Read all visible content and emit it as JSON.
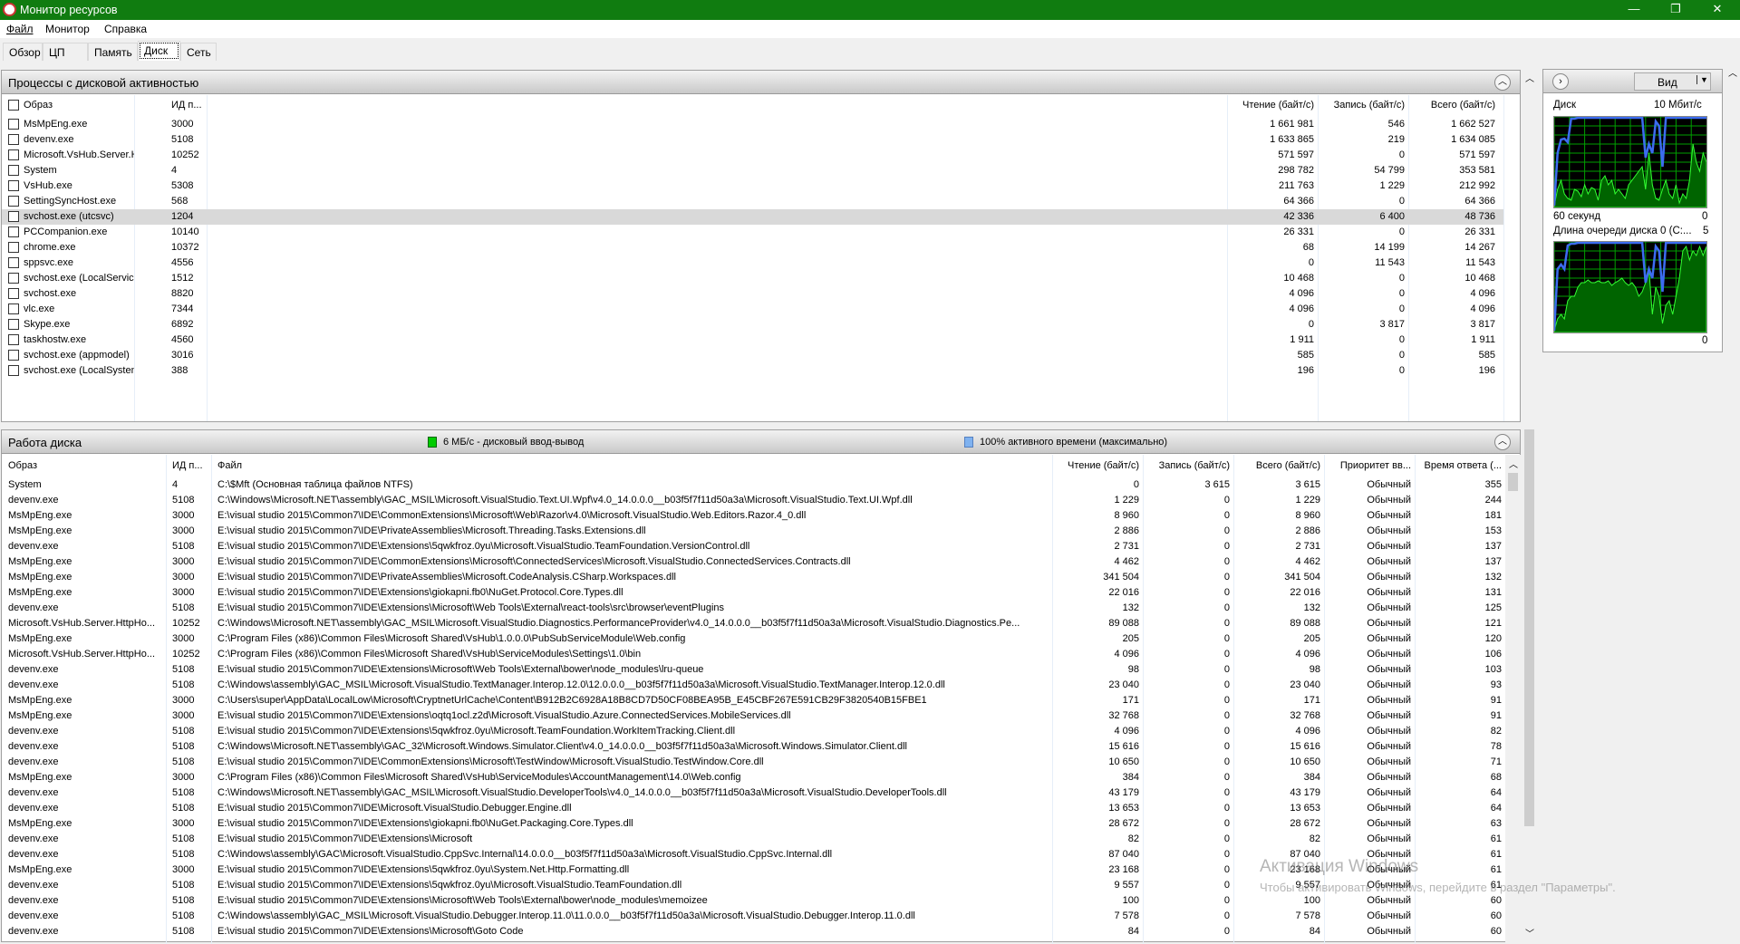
{
  "window": {
    "title": "Монитор ресурсов",
    "minimize": "—",
    "restore": "❐",
    "close": "✕"
  },
  "menu": [
    "Файл",
    "Монитор",
    "Справка"
  ],
  "tabs": [
    "Обзор",
    "ЦП",
    "Память",
    "Диск",
    "Сеть"
  ],
  "active_tab": "Диск",
  "processes": {
    "title": "Процессы с дисковой активностью",
    "columns": [
      "Образ",
      "ИД п...",
      "Чтение (байт/с)",
      "Запись (байт/с)",
      "Всего (байт/с)"
    ],
    "rows": [
      [
        "MsMpEng.exe",
        "3000",
        "1 661 981",
        "546",
        "1 662 527"
      ],
      [
        "devenv.exe",
        "5108",
        "1 633 865",
        "219",
        "1 634 085"
      ],
      [
        "Microsoft.VsHub.Server.Htt...",
        "10252",
        "571 597",
        "0",
        "571 597"
      ],
      [
        "System",
        "4",
        "298 782",
        "54 799",
        "353 581"
      ],
      [
        "VsHub.exe",
        "5308",
        "211 763",
        "1 229",
        "212 992"
      ],
      [
        "SettingSyncHost.exe",
        "568",
        "64 366",
        "0",
        "64 366"
      ],
      [
        "svchost.exe (utcsvc)",
        "1204",
        "42 336",
        "6 400",
        "48 736"
      ],
      [
        "PCCompanion.exe",
        "10140",
        "26 331",
        "0",
        "26 331"
      ],
      [
        "chrome.exe",
        "10372",
        "68",
        "14 199",
        "14 267"
      ],
      [
        "sppsvc.exe",
        "4556",
        "0",
        "11 543",
        "11 543"
      ],
      [
        "svchost.exe (LocalService)",
        "1512",
        "10 468",
        "0",
        "10 468"
      ],
      [
        "svchost.exe",
        "8820",
        "4 096",
        "0",
        "4 096"
      ],
      [
        "vlc.exe",
        "7344",
        "4 096",
        "0",
        "4 096"
      ],
      [
        "Skype.exe",
        "6892",
        "0",
        "3 817",
        "3 817"
      ],
      [
        "taskhostw.exe",
        "4560",
        "1 911",
        "0",
        "1 911"
      ],
      [
        "svchost.exe (appmodel)",
        "3016",
        "585",
        "0",
        "585"
      ],
      [
        "svchost.exe (LocalSystemNet...",
        "388",
        "196",
        "0",
        "196"
      ]
    ],
    "selected_row": 6
  },
  "disk": {
    "title": "Работа диска",
    "legend_io": "6 МБ/с - дисковый ввод-вывод",
    "legend_active": "100% активного времени (максимально)",
    "io_color": "#00cc00",
    "active_color": "#7fb2f0",
    "columns": [
      "Образ",
      "ИД п...",
      "Файл",
      "Чтение (байт/с)",
      "Запись (байт/с)",
      "Всего (байт/с)",
      "Приоритет вв...",
      "Время ответа (..."
    ],
    "rows": [
      [
        "System",
        "4",
        "C:\\$Mft (Основная таблица файлов NTFS)",
        "0",
        "3 615",
        "3 615",
        "Обычный",
        "355"
      ],
      [
        "devenv.exe",
        "5108",
        "C:\\Windows\\Microsoft.NET\\assembly\\GAC_MSIL\\Microsoft.VisualStudio.Text.UI.Wpf\\v4.0_14.0.0.0__b03f5f7f11d50a3a\\Microsoft.VisualStudio.Text.UI.Wpf.dll",
        "1 229",
        "0",
        "1 229",
        "Обычный",
        "244"
      ],
      [
        "MsMpEng.exe",
        "3000",
        "E:\\visual studio 2015\\Common7\\IDE\\CommonExtensions\\Microsoft\\Web\\Razor\\v4.0\\Microsoft.VisualStudio.Web.Editors.Razor.4_0.dll",
        "8 960",
        "0",
        "8 960",
        "Обычный",
        "181"
      ],
      [
        "MsMpEng.exe",
        "3000",
        "E:\\visual studio 2015\\Common7\\IDE\\PrivateAssemblies\\Microsoft.Threading.Tasks.Extensions.dll",
        "2 886",
        "0",
        "2 886",
        "Обычный",
        "153"
      ],
      [
        "devenv.exe",
        "5108",
        "E:\\visual studio 2015\\Common7\\IDE\\Extensions\\5qwkfroz.0yu\\Microsoft.VisualStudio.TeamFoundation.VersionControl.dll",
        "2 731",
        "0",
        "2 731",
        "Обычный",
        "137"
      ],
      [
        "MsMpEng.exe",
        "3000",
        "E:\\visual studio 2015\\Common7\\IDE\\CommonExtensions\\Microsoft\\ConnectedServices\\Microsoft.VisualStudio.ConnectedServices.Contracts.dll",
        "4 462",
        "0",
        "4 462",
        "Обычный",
        "137"
      ],
      [
        "MsMpEng.exe",
        "3000",
        "E:\\visual studio 2015\\Common7\\IDE\\PrivateAssemblies\\Microsoft.CodeAnalysis.CSharp.Workspaces.dll",
        "341 504",
        "0",
        "341 504",
        "Обычный",
        "132"
      ],
      [
        "MsMpEng.exe",
        "3000",
        "E:\\visual studio 2015\\Common7\\IDE\\Extensions\\giokapni.fb0\\NuGet.Protocol.Core.Types.dll",
        "22 016",
        "0",
        "22 016",
        "Обычный",
        "131"
      ],
      [
        "devenv.exe",
        "5108",
        "E:\\visual studio 2015\\Common7\\IDE\\Extensions\\Microsoft\\Web Tools\\External\\react-tools\\src\\browser\\eventPlugins",
        "132",
        "0",
        "132",
        "Обычный",
        "125"
      ],
      [
        "Microsoft.VsHub.Server.HttpHo...",
        "10252",
        "C:\\Windows\\Microsoft.NET\\assembly\\GAC_MSIL\\Microsoft.VisualStudio.Diagnostics.PerformanceProvider\\v4.0_14.0.0.0__b03f5f7f11d50a3a\\Microsoft.VisualStudio.Diagnostics.Pe...",
        "89 088",
        "0",
        "89 088",
        "Обычный",
        "121"
      ],
      [
        "MsMpEng.exe",
        "3000",
        "C:\\Program Files (x86)\\Common Files\\Microsoft Shared\\VsHub\\1.0.0.0\\PubSubServiceModule\\Web.config",
        "205",
        "0",
        "205",
        "Обычный",
        "120"
      ],
      [
        "Microsoft.VsHub.Server.HttpHo...",
        "10252",
        "C:\\Program Files (x86)\\Common Files\\Microsoft Shared\\VsHub\\ServiceModules\\Settings\\1.0\\bin",
        "4 096",
        "0",
        "4 096",
        "Обычный",
        "106"
      ],
      [
        "devenv.exe",
        "5108",
        "E:\\visual studio 2015\\Common7\\IDE\\Extensions\\Microsoft\\Web Tools\\External\\bower\\node_modules\\lru-queue",
        "98",
        "0",
        "98",
        "Обычный",
        "103"
      ],
      [
        "devenv.exe",
        "5108",
        "C:\\Windows\\assembly\\GAC_MSIL\\Microsoft.VisualStudio.TextManager.Interop.12.0\\12.0.0.0__b03f5f7f11d50a3a\\Microsoft.VisualStudio.TextManager.Interop.12.0.dll",
        "23 040",
        "0",
        "23 040",
        "Обычный",
        "93"
      ],
      [
        "MsMpEng.exe",
        "3000",
        "C:\\Users\\super\\AppData\\LocalLow\\Microsoft\\CryptnetUrlCache\\Content\\B912B2C6928A18B8CD7D50CF08BEA95B_E45CBF267E591CB29F3820540B15FBE1",
        "171",
        "0",
        "171",
        "Обычный",
        "91"
      ],
      [
        "MsMpEng.exe",
        "3000",
        "E:\\visual studio 2015\\Common7\\IDE\\Extensions\\oqtq1ocl.z2d\\Microsoft.VisualStudio.Azure.ConnectedServices.MobileServices.dll",
        "32 768",
        "0",
        "32 768",
        "Обычный",
        "91"
      ],
      [
        "devenv.exe",
        "5108",
        "E:\\visual studio 2015\\Common7\\IDE\\Extensions\\5qwkfroz.0yu\\Microsoft.TeamFoundation.WorkItemTracking.Client.dll",
        "4 096",
        "0",
        "4 096",
        "Обычный",
        "82"
      ],
      [
        "devenv.exe",
        "5108",
        "C:\\Windows\\Microsoft.NET\\assembly\\GAC_32\\Microsoft.Windows.Simulator.Client\\v4.0_14.0.0.0__b03f5f7f11d50a3a\\Microsoft.Windows.Simulator.Client.dll",
        "15 616",
        "0",
        "15 616",
        "Обычный",
        "78"
      ],
      [
        "devenv.exe",
        "5108",
        "E:\\visual studio 2015\\Common7\\IDE\\CommonExtensions\\Microsoft\\TestWindow\\Microsoft.VisualStudio.TestWindow.Core.dll",
        "10 650",
        "0",
        "10 650",
        "Обычный",
        "71"
      ],
      [
        "MsMpEng.exe",
        "3000",
        "C:\\Program Files (x86)\\Common Files\\Microsoft Shared\\VsHub\\ServiceModules\\AccountManagement\\14.0\\Web.config",
        "384",
        "0",
        "384",
        "Обычный",
        "68"
      ],
      [
        "devenv.exe",
        "5108",
        "C:\\Windows\\Microsoft.NET\\assembly\\GAC_MSIL\\Microsoft.VisualStudio.DeveloperTools\\v4.0_14.0.0.0__b03f5f7f11d50a3a\\Microsoft.VisualStudio.DeveloperTools.dll",
        "43 179",
        "0",
        "43 179",
        "Обычный",
        "64"
      ],
      [
        "devenv.exe",
        "5108",
        "E:\\visual studio 2015\\Common7\\IDE\\Microsoft.VisualStudio.Debugger.Engine.dll",
        "13 653",
        "0",
        "13 653",
        "Обычный",
        "64"
      ],
      [
        "MsMpEng.exe",
        "3000",
        "E:\\visual studio 2015\\Common7\\IDE\\Extensions\\giokapni.fb0\\NuGet.Packaging.Core.Types.dll",
        "28 672",
        "0",
        "28 672",
        "Обычный",
        "63"
      ],
      [
        "devenv.exe",
        "5108",
        "E:\\visual studio 2015\\Common7\\IDE\\Extensions\\Microsoft",
        "82",
        "0",
        "82",
        "Обычный",
        "61"
      ],
      [
        "devenv.exe",
        "5108",
        "C:\\Windows\\assembly\\GAC\\Microsoft.VisualStudio.CppSvc.Internal\\14.0.0.0__b03f5f7f11d50a3a\\Microsoft.VisualStudio.CppSvc.Internal.dll",
        "87 040",
        "0",
        "87 040",
        "Обычный",
        "61"
      ],
      [
        "MsMpEng.exe",
        "3000",
        "E:\\visual studio 2015\\Common7\\IDE\\Extensions\\5qwkfroz.0yu\\System.Net.Http.Formatting.dll",
        "23 168",
        "0",
        "23 168",
        "Обычный",
        "61"
      ],
      [
        "devenv.exe",
        "5108",
        "E:\\visual studio 2015\\Common7\\IDE\\Extensions\\5qwkfroz.0yu\\Microsoft.VisualStudio.TeamFoundation.dll",
        "9 557",
        "0",
        "9 557",
        "Обычный",
        "61"
      ],
      [
        "devenv.exe",
        "5108",
        "E:\\visual studio 2015\\Common7\\IDE\\Extensions\\Microsoft\\Web Tools\\External\\bower\\node_modules\\memoizee",
        "100",
        "0",
        "100",
        "Обычный",
        "60"
      ],
      [
        "devenv.exe",
        "5108",
        "C:\\Windows\\assembly\\GAC_MSIL\\Microsoft.VisualStudio.Debugger.Interop.11.0\\11.0.0.0__b03f5f7f11d50a3a\\Microsoft.VisualStudio.Debugger.Interop.11.0.dll",
        "7 578",
        "0",
        "7 578",
        "Обычный",
        "60"
      ],
      [
        "devenv.exe",
        "5108",
        "E:\\visual studio 2015\\Common7\\IDE\\Extensions\\Microsoft\\Goto Code",
        "84",
        "0",
        "84",
        "Обычный",
        "60"
      ]
    ]
  },
  "graphs": {
    "view_label": "Вид",
    "disk_label": "Диск",
    "disk_max": "10 Мбит/с",
    "time_span": "60 секунд",
    "disk_min": "0",
    "queue_label": "Длина очереди диска 0 (C:...",
    "queue_max": "5",
    "queue_min": "0"
  },
  "watermark": {
    "line1": "Активация Windows",
    "line2": "Чтобы активировать Windows, перейдите в раздел \"Параметры\"."
  }
}
